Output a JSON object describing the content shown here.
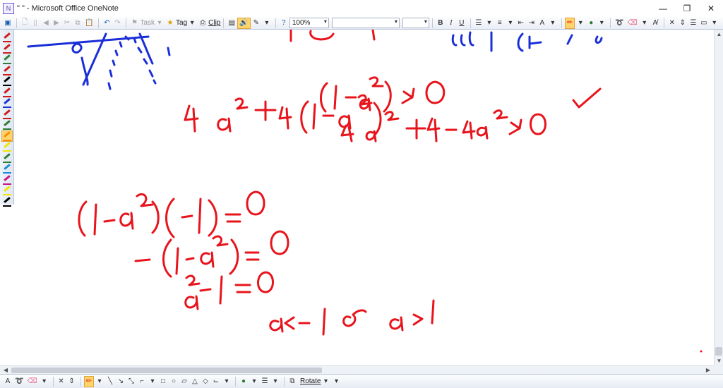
{
  "window": {
    "title": "\" \" - Microsoft Office OneNote",
    "icon": "onenote-icon",
    "controls": {
      "minimize": "—",
      "restore": "❐",
      "close": "✕"
    }
  },
  "toolbar": {
    "task_label": "Task",
    "tag_label": "Tag",
    "clip_label": "Clip",
    "zoom_value": "100%",
    "font_name": "",
    "font_size": "",
    "bold": "B",
    "italic": "I",
    "underline": "U"
  },
  "drawbar": {
    "text_tool": "A",
    "rotate_label": "Rotate"
  },
  "colors": {
    "ink_red": "#e8141c",
    "ink_blue": "#1a2fd8",
    "accent_selected": "#ffd46b",
    "toolbar_bg": "#e9eef6"
  },
  "pens": [
    {
      "color": "#d11b1b",
      "selected": false
    },
    {
      "color": "#d11b1b",
      "selected": false
    },
    {
      "color": "#2e7d32",
      "selected": false
    },
    {
      "color": "#d11b1b",
      "selected": false
    },
    {
      "color": "#000000",
      "selected": false
    },
    {
      "color": "#d11b1b",
      "selected": false
    },
    {
      "color": "#1a2fd8",
      "selected": false
    },
    {
      "color": "#d11b1b",
      "selected": false
    },
    {
      "color": "#2e7d32",
      "selected": false
    },
    {
      "color": "#ff8c00",
      "selected": true
    },
    {
      "color": "#f5e400",
      "selected": false
    },
    {
      "color": "#2e7d32",
      "selected": false
    },
    {
      "color": "#1a8fd8",
      "selected": false
    },
    {
      "color": "#c71585",
      "selected": false
    },
    {
      "color": "#f5e400",
      "selected": false
    },
    {
      "color": "#000000",
      "selected": false
    }
  ]
}
